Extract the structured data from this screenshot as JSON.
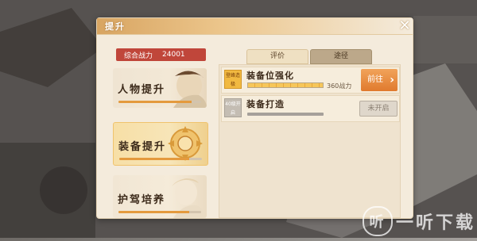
{
  "panel": {
    "title": "提升"
  },
  "power": {
    "label": "综合战力",
    "value": "24001"
  },
  "tabs": [
    {
      "label": "评价"
    },
    {
      "label": "途径"
    }
  ],
  "categories": [
    {
      "label": "人物提升",
      "progress": 0.88
    },
    {
      "label": "装备提升",
      "progress": 0.85
    },
    {
      "label": "护驾培养",
      "progress": 0.86
    }
  ],
  "rows": [
    {
      "badge": "登峰造极",
      "title": "装备位强化",
      "progress": 1.0,
      "power_text": "360战力",
      "button": "前往"
    },
    {
      "badge": "40级开启",
      "title": "装备打造",
      "progress": 1.0,
      "button": "未开启"
    }
  ],
  "watermark": {
    "icon": "听",
    "text": "一听下载"
  }
}
